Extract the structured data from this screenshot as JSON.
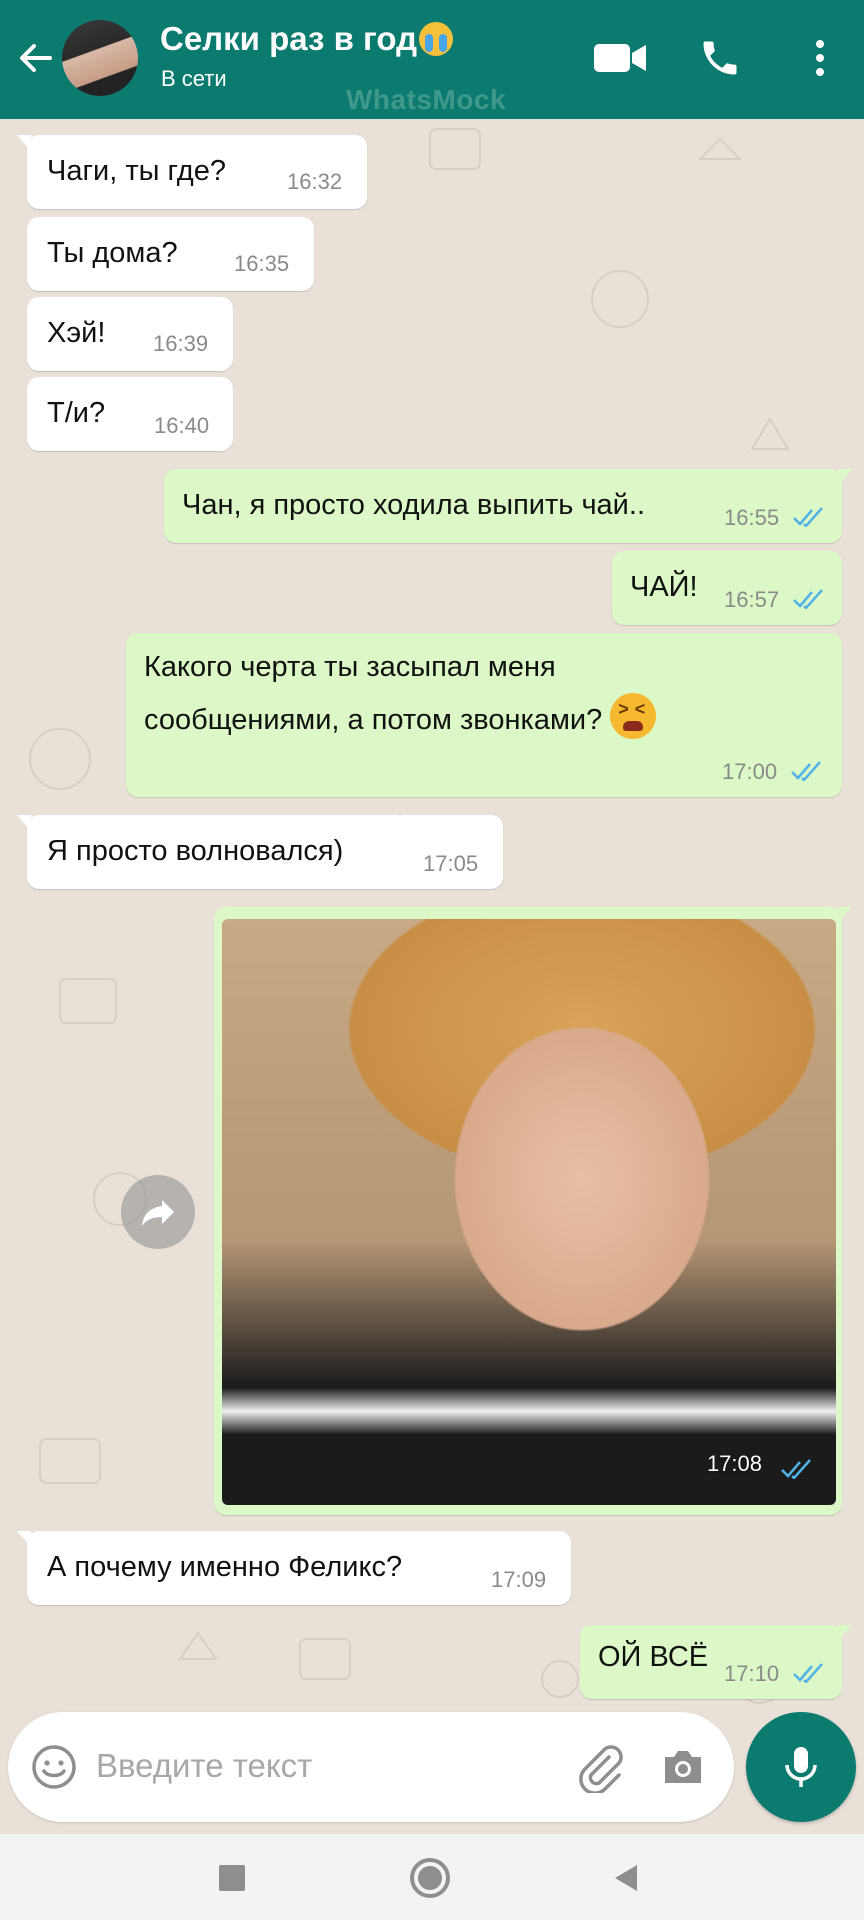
{
  "header": {
    "title": "Селки раз в год",
    "title_emoji": "loudly-crying-face",
    "status": "В сети",
    "watermark": "WhatsMock",
    "bg_color": "#0b7a6f"
  },
  "messages": [
    {
      "dir": "in",
      "text": "Чаги, ты где?",
      "time": "16:32"
    },
    {
      "dir": "in",
      "text": "Ты дома?",
      "time": "16:35"
    },
    {
      "dir": "in",
      "text": "Хэй!",
      "time": "16:39"
    },
    {
      "dir": "in",
      "text": "Т/и?",
      "time": "16:40"
    },
    {
      "dir": "out",
      "text": "Чан, я просто ходила выпить чай..",
      "time": "16:55",
      "read": true
    },
    {
      "dir": "out",
      "text": "ЧАЙ!",
      "time": "16:57",
      "read": true
    },
    {
      "dir": "out",
      "line1": "Какого черта ты засыпал меня",
      "line2": "сообщениями, а потом звонками?",
      "emoji": "tired-face",
      "time": "17:00",
      "read": true
    },
    {
      "dir": "in",
      "text": "Я просто волновался)",
      "time": "17:05"
    },
    {
      "dir": "out",
      "type": "image",
      "time": "17:08",
      "read": true
    },
    {
      "dir": "in",
      "text": "А почему именно Феликс?",
      "time": "17:09"
    },
    {
      "dir": "out",
      "text": "ОЙ ВСЁ",
      "time": "17:10",
      "read": true
    }
  ],
  "input": {
    "placeholder": "Введите текст"
  },
  "colors": {
    "incoming": "#ffffff",
    "outgoing": "#dcf8c6",
    "read_ticks": "#4fb3e8",
    "wallpaper": "#e9e1d8"
  }
}
